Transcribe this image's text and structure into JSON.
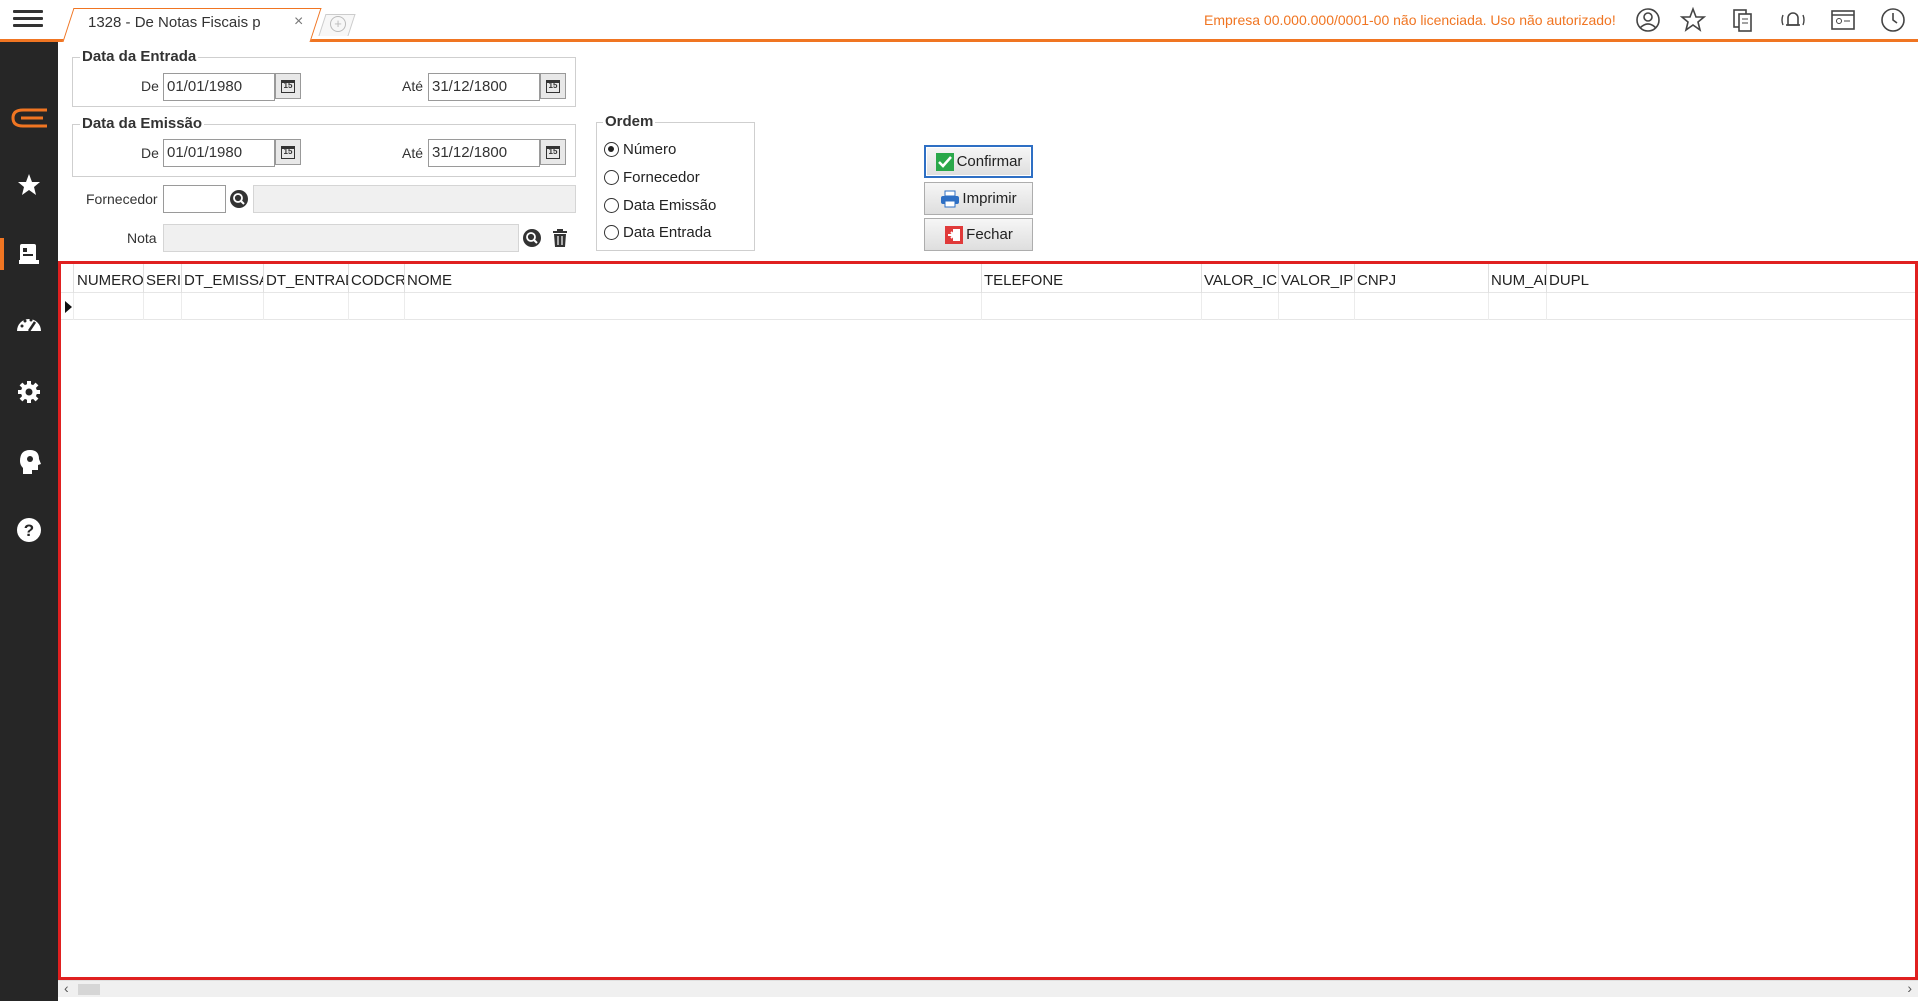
{
  "topbar": {
    "tab_title": "1328 - De Notas Fiscais p",
    "tab_close": "×",
    "license_warning": "Empresa 00.000.000/0001-00 não licenciada. Uso não autorizado!"
  },
  "sidebar": {
    "items": [
      {
        "icon": "logo-icon"
      },
      {
        "icon": "star-icon"
      },
      {
        "icon": "report-icon"
      },
      {
        "icon": "dashboard-icon"
      },
      {
        "icon": "gear-icon"
      },
      {
        "icon": "head-gear-icon"
      },
      {
        "icon": "help-icon"
      }
    ]
  },
  "entrada": {
    "title": "Data da Entrada",
    "de_label": "De",
    "de_value": "01/01/1980",
    "ate_label": "Até",
    "ate_value": "31/12/1800"
  },
  "emissao": {
    "title": "Data da Emissão",
    "de_label": "De",
    "de_value": "01/01/1980",
    "ate_label": "Até",
    "ate_value": "31/12/1800"
  },
  "fornecedor": {
    "label": "Fornecedor",
    "code": "",
    "name": ""
  },
  "nota": {
    "label": "Nota",
    "value": ""
  },
  "ordem": {
    "title": "Ordem",
    "options": [
      "Número",
      "Fornecedor",
      "Data Emissão",
      "Data Entrada"
    ],
    "selected": "Número"
  },
  "buttons": {
    "confirmar": "Confirmar",
    "imprimir": "Imprimir",
    "fechar": "Fechar"
  },
  "grid": {
    "columns": [
      "NUMERO",
      "SERIE",
      "DT_EMISSAO",
      "DT_ENTRADA",
      "CODCRE",
      "NOME",
      "TELEFONE",
      "VALOR_ICM",
      "VALOR_IPI",
      "CNPJ",
      "NUM_AP",
      "DUPL"
    ],
    "rows": []
  },
  "colors": {
    "accent": "#f07522",
    "sidebar_bg": "#262626",
    "grid_highlight": "#e02020",
    "primary_border": "#2e6fc4"
  }
}
